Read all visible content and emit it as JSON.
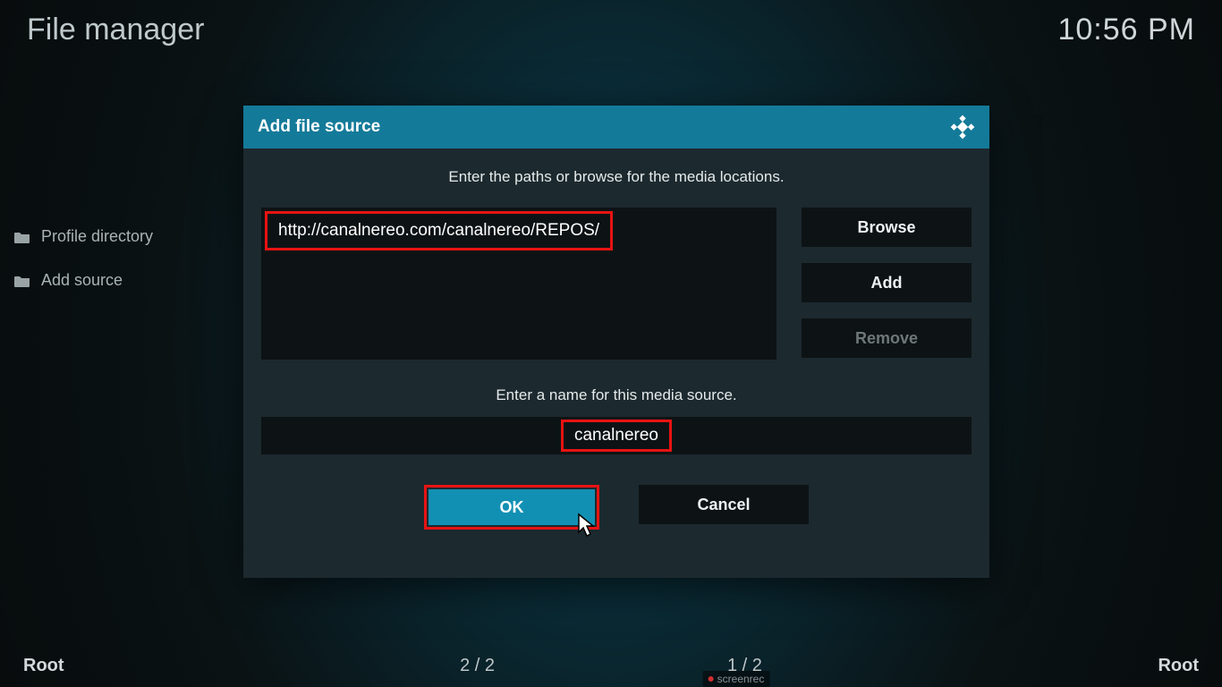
{
  "header": {
    "title": "File manager",
    "clock": "10:56 PM"
  },
  "sidebar": {
    "items": [
      {
        "label": "Profile directory"
      },
      {
        "label": "Add source"
      }
    ]
  },
  "dialog": {
    "title": "Add file source",
    "paths_instruction": "Enter the paths or browse for the media locations.",
    "path_value": "http://canalnereo.com/canalnereo/REPOS/",
    "browse_label": "Browse",
    "add_label": "Add",
    "remove_label": "Remove",
    "name_instruction": "Enter a name for this media source.",
    "name_value": "canalnereo",
    "ok_label": "OK",
    "cancel_label": "Cancel"
  },
  "footer": {
    "left": "Root",
    "count_left": "2 / 2",
    "count_right": "1 / 2",
    "right": "Root",
    "watermark": "screenrec"
  }
}
